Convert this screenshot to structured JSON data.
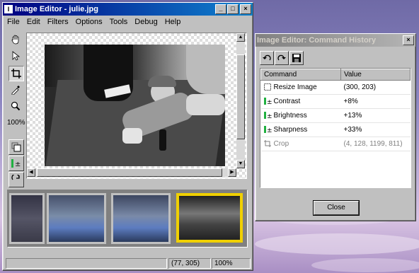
{
  "editor": {
    "title": "Image Editor - julie.jpg",
    "menu": [
      "File",
      "Edit",
      "Filters",
      "Options",
      "Tools",
      "Debug",
      "Help"
    ],
    "zoom_label": "100%",
    "status_coords": "(77, 305)",
    "status_zoom": "100%",
    "tools": [
      "hand-tool",
      "pointer-tool",
      "crop-tool",
      "eyedropper-tool",
      "zoom-tool"
    ]
  },
  "history": {
    "title": "Image Editor: Command History",
    "columns": [
      "Command",
      "Value"
    ],
    "rows": [
      {
        "command": "Resize Image",
        "value": "(300, 203)"
      },
      {
        "command": "Contrast",
        "value": "+8%"
      },
      {
        "command": "Brightness",
        "value": "+13%"
      },
      {
        "command": "Sharpness",
        "value": "+33%"
      },
      {
        "command": "Crop",
        "value": "(4, 128, 1199, 811)"
      }
    ],
    "close_label": "Close"
  },
  "colors": {
    "active_title": "#000080",
    "thumb_selected": "#f0d000",
    "level_bar": "#20b040"
  }
}
